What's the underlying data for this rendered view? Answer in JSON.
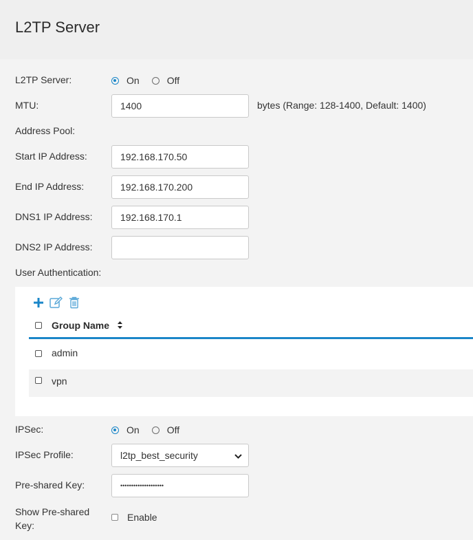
{
  "header": {
    "title": "L2TP Server"
  },
  "l2tp_server": {
    "label": "L2TP Server:",
    "on_label": "On",
    "off_label": "Off",
    "selected": "On"
  },
  "mtu": {
    "label": "MTU:",
    "value": "1400",
    "hint": "bytes (Range: 128-1400, Default: 1400)"
  },
  "address_pool": {
    "label": "Address Pool:",
    "start_ip": {
      "label": "Start IP Address:",
      "value": "192.168.170.50"
    },
    "end_ip": {
      "label": "End IP Address:",
      "value": "192.168.170.200"
    },
    "dns1": {
      "label": "DNS1 IP Address:",
      "value": "192.168.170.1"
    },
    "dns2": {
      "label": "DNS2 IP Address:",
      "value": ""
    }
  },
  "user_auth": {
    "label": "User Authentication:",
    "column_header": "Group Name",
    "rows": [
      {
        "name": "admin"
      },
      {
        "name": "vpn"
      }
    ]
  },
  "ipsec": {
    "label": "IPSec:",
    "on_label": "On",
    "off_label": "Off",
    "selected": "On"
  },
  "ipsec_profile": {
    "label": "IPSec Profile:",
    "value": "l2tp_best_security"
  },
  "psk": {
    "label": "Pre-shared Key:",
    "value": "••••••••••••••••••••"
  },
  "show_psk": {
    "label_line1": "Show Pre-shared",
    "label_line2": "Key:",
    "checkbox_label": "Enable"
  },
  "colors": {
    "accent": "#1a86c8"
  }
}
